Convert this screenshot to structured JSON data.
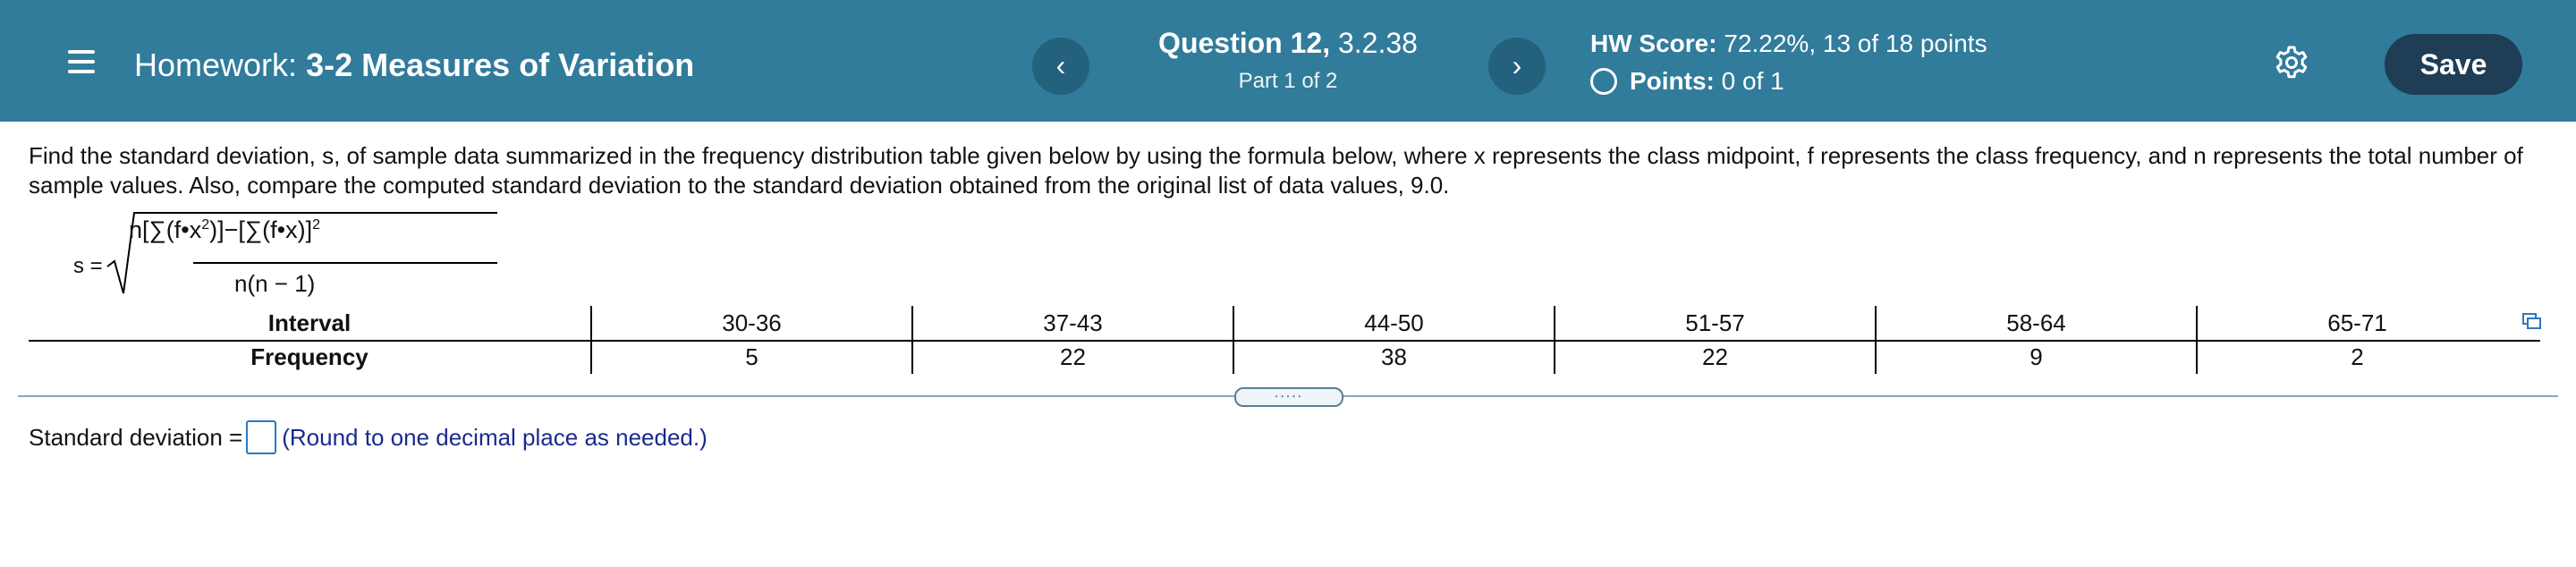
{
  "header": {
    "title_prefix": "Homework:",
    "title": "3-2 Measures of Variation",
    "prev_label": "‹",
    "next_label": "›",
    "question_label": "Question 12,",
    "question_id": "3.2.38",
    "part_label": "Part 1 of 2",
    "hw_score_label": "HW Score:",
    "hw_score_value": "72.22%, 13 of 18 points",
    "points_label": "Points:",
    "points_value": "0 of 1",
    "save_label": "Save",
    "icons": {
      "menu": "menu-icon",
      "settings": "gear-icon",
      "points_status": "circle-icon"
    },
    "colors": {
      "bar": "#317b9b",
      "save_button": "#1f3d55"
    }
  },
  "problem": {
    "instructions": "Find the standard deviation, s, of sample data summarized in the frequency distribution table given below by using the formula below, where x represents the class midpoint, f represents the class frequency, and n represents the total number of sample values. Also, compare the computed standard deviation to the standard deviation obtained from the original list of data values, 9.0.",
    "formula_lhs": "s =",
    "formula_denominator": "n(n − 1)"
  },
  "table": {
    "row_headers": [
      "Interval",
      "Frequency"
    ],
    "intervals": [
      "30-36",
      "37-43",
      "44-50",
      "51-57",
      "58-64",
      "65-71"
    ],
    "frequencies": [
      "5",
      "22",
      "38",
      "22",
      "9",
      "2"
    ]
  },
  "answer": {
    "label": "Standard deviation =",
    "value": "",
    "hint": "(Round to one decimal place as needed.)"
  },
  "expand_handle_label": "....."
}
